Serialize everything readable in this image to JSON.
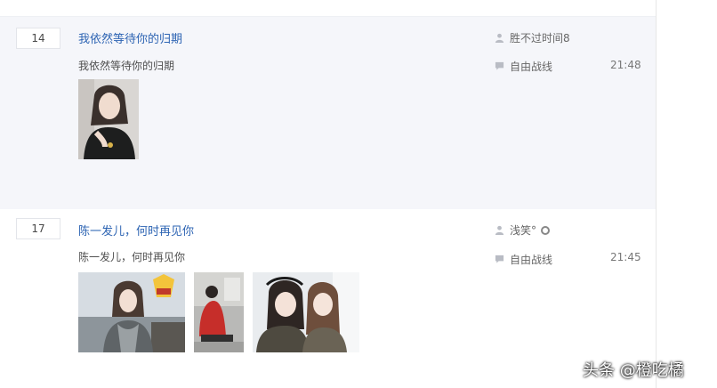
{
  "threads": [
    {
      "reply_count": "14",
      "title": "我依然等待你的归期",
      "abstract": "我依然等待你的归期",
      "author": "胜不过时间8",
      "last_reply_user": "自由战线",
      "last_reply_time": "21:48",
      "images": [
        "woman-portrait-dark-sweater"
      ]
    },
    {
      "reply_count": "17",
      "title": "陈一发儿，何时再见你",
      "abstract": "陈一发儿，何时再见你",
      "author": "浅笑°",
      "last_reply_user": "自由战线",
      "last_reply_time": "21:45",
      "images": [
        "woman-by-sea-scarf",
        "woman-red-coat-sitting",
        "two-girls-selfie"
      ]
    }
  ],
  "icons": {
    "author": "user-icon",
    "reply": "comment-icon",
    "badge": "circle-badge-icon"
  },
  "watermark": "头条 @橙吃橘",
  "colors": {
    "title": "#2d64b3",
    "thread_bg": "#f5f6fa"
  }
}
